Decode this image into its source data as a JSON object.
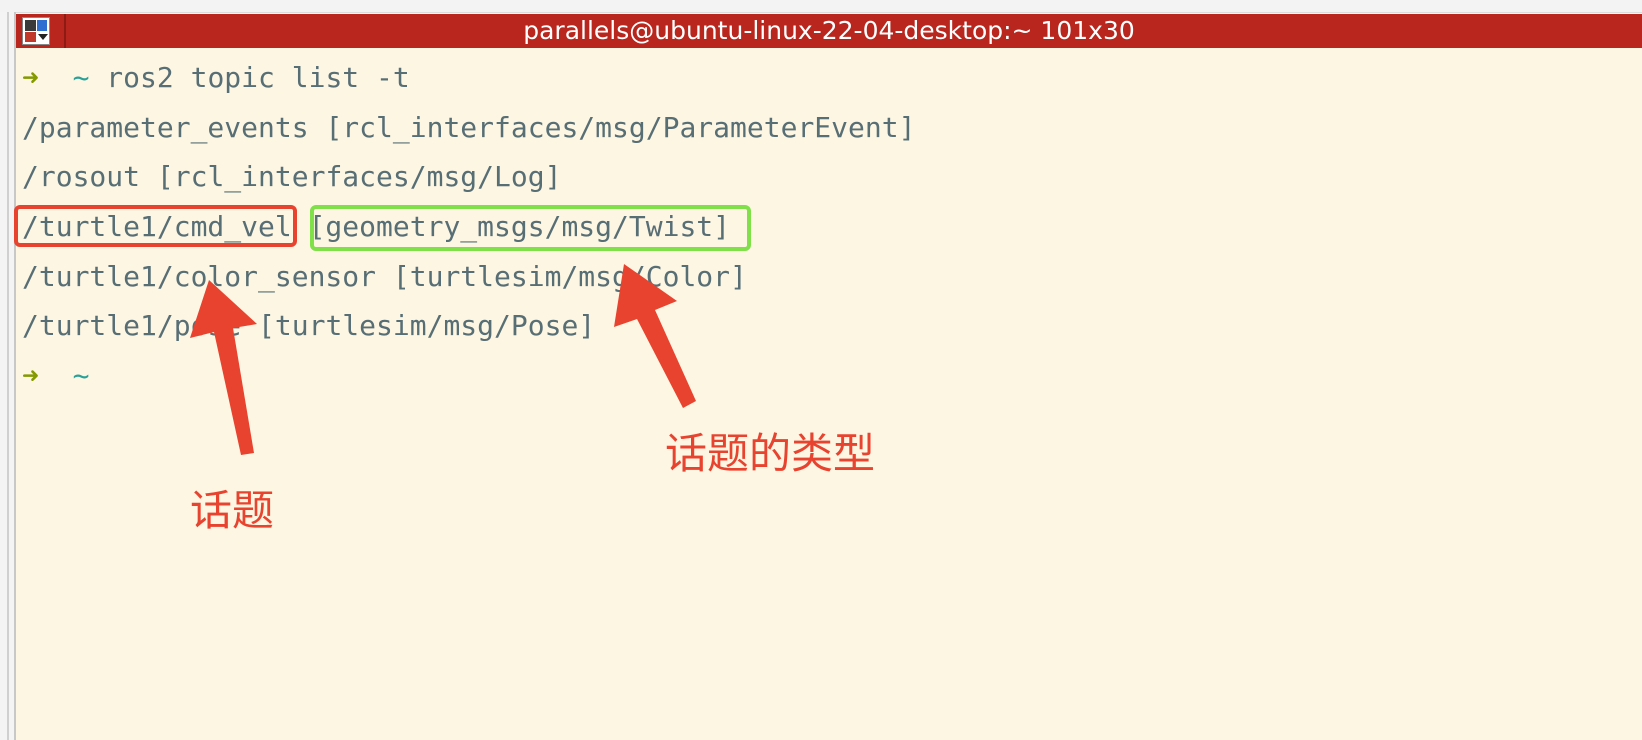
{
  "window": {
    "title": "parallels@ubuntu-linux-22-04-desktop:~ 101x30"
  },
  "terminal": {
    "prompt_symbol": "➜",
    "cwd": "~",
    "command": "ros2 topic list -t",
    "output": [
      {
        "topic": "/parameter_events",
        "type": "[rcl_interfaces/msg/ParameterEvent]"
      },
      {
        "topic": "/rosout",
        "type": "[rcl_interfaces/msg/Log]"
      },
      {
        "topic": "/turtle1/cmd_vel",
        "type": "[geometry_msgs/msg/Twist]"
      },
      {
        "topic": "/turtle1/color_sensor",
        "type": "[turtlesim/msg/Color]"
      },
      {
        "topic": "/turtle1/pose",
        "type": "[turtlesim/msg/Pose]"
      }
    ]
  },
  "annotations": {
    "topic_label": "话题",
    "type_label": "话题的类型",
    "red_color": "#e8432f",
    "green_color": "#7fe04a"
  },
  "colors": {
    "titlebar": "#b8261e",
    "background": "#fdf6e3",
    "text": "#586e75",
    "prompt_arrow": "#859900",
    "prompt_tilde": "#2aa198"
  }
}
